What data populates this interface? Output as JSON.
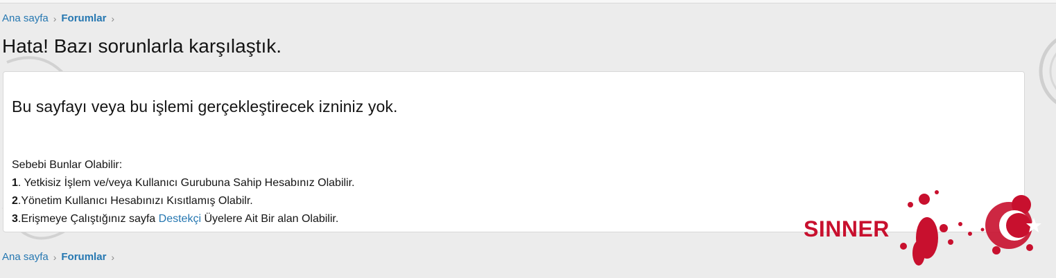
{
  "breadcrumb": {
    "items": [
      {
        "label": "Ana sayfa"
      },
      {
        "label": "Forumlar"
      }
    ]
  },
  "page": {
    "title": "Hata! Bazı sorunlarla karşılaştık."
  },
  "error": {
    "heading": "Bu sayfayı veya bu işlemi gerçekleştirecek izniniz yok.",
    "intro": "Sebebi Bunlar Olabilir:",
    "reasons": [
      {
        "num": "1",
        "text": ". Yetkisiz İşlem ve/veya Kullanıcı Gurubuna Sahip Hesabınız Olabilir."
      },
      {
        "num": "2",
        "text": ".Yönetim Kullanıcı Hesabınızı Kısıtlamış Olabilr."
      },
      {
        "num": "3",
        "text_before": ".Erişmeye Çalıştığınız sayfa ",
        "link": "Destekçi",
        "text_after": " Üyelere Ait Bir alan Olabilir."
      }
    ]
  },
  "watermark": {
    "text": "SINNER",
    "color": "#c8102e"
  },
  "colors": {
    "link": "#2577b1",
    "background": "#ececec",
    "panel": "#ffffff"
  }
}
